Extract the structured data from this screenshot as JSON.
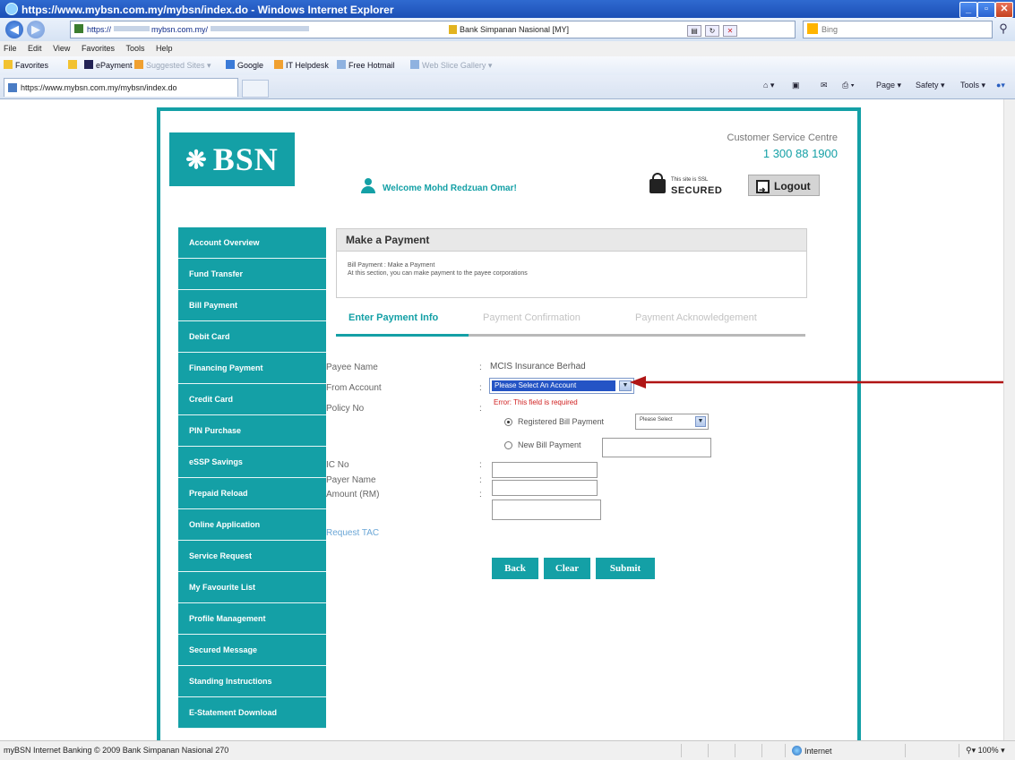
{
  "browser": {
    "window_title": "https://www.mybsn.com.my/mybsn/index.do - Windows Internet Explorer",
    "address_prefix": "https://",
    "address_domain": "mybsn.com.my/",
    "certificate": "Bank Simpanan Nasional [MY]",
    "search_placeholder": "Bing",
    "menu": [
      "File",
      "Edit",
      "View",
      "Favorites",
      "Tools",
      "Help"
    ],
    "favorites_label": "Favorites",
    "favorites": [
      "ePayment",
      "Suggested Sites",
      "Google",
      "IT Helpdesk",
      "Free Hotmail",
      "Web Slice Gallery"
    ],
    "tab_title": "https://www.mybsn.com.my/mybsn/index.do",
    "commands": [
      "Page",
      "Safety",
      "Tools"
    ],
    "status_text": "myBSN Internet Banking © 2009 Bank Simpanan Nasional 270",
    "zone": "Internet",
    "zoom": "100%"
  },
  "site": {
    "logo": "BSN",
    "customer_service_label": "Customer Service Centre",
    "customer_service_phone": "1 300 88 1900",
    "welcome": "Welcome Mohd Redzuan Omar!",
    "secured_small": "This site is SSL",
    "secured_big": "SECURED",
    "logout": "Logout",
    "sidebar": [
      "Account Overview",
      "Fund Transfer",
      "Bill Payment",
      "Debit Card",
      "Financing Payment",
      "Credit Card",
      "PIN Purchase",
      "eSSP Savings",
      "Prepaid Reload",
      "Online Application",
      "Service Request",
      "My Favourite List",
      "Profile Management",
      "Secured Message",
      "Standing Instructions",
      "E-Statement Download"
    ]
  },
  "payment": {
    "title": "Make a Payment",
    "breadcrumb": "Bill Payment : Make a Payment",
    "description": "At this section, you can make payment to the payee corporations",
    "steps": [
      "Enter Payment Info",
      "Payment Confirmation",
      "Payment Acknowledgement"
    ],
    "labels": {
      "payee_name": "Payee Name",
      "from_account": "From Account",
      "policy_no": "Policy No",
      "ic_no": "IC No",
      "payer_name": "Payer Name",
      "amount": "Amount (RM)"
    },
    "payee_value": "MCIS Insurance Berhad",
    "account_select": "Please Select An Account",
    "error": "Error: This field is required",
    "registered_label": "Registered Bill Payment",
    "registered_select": "Please Select",
    "new_label": "New Bill Payment",
    "request_tac": "Request TAC",
    "buttons": {
      "back": "Back",
      "clear": "Clear",
      "submit": "Submit"
    },
    "values": {
      "policy_no": "",
      "ic_no": "",
      "payer_name": "",
      "amount": ""
    }
  },
  "colors": {
    "brand_teal": "#14a0a6",
    "error_red": "#d02020",
    "annotation_arrow": "#b01515"
  }
}
